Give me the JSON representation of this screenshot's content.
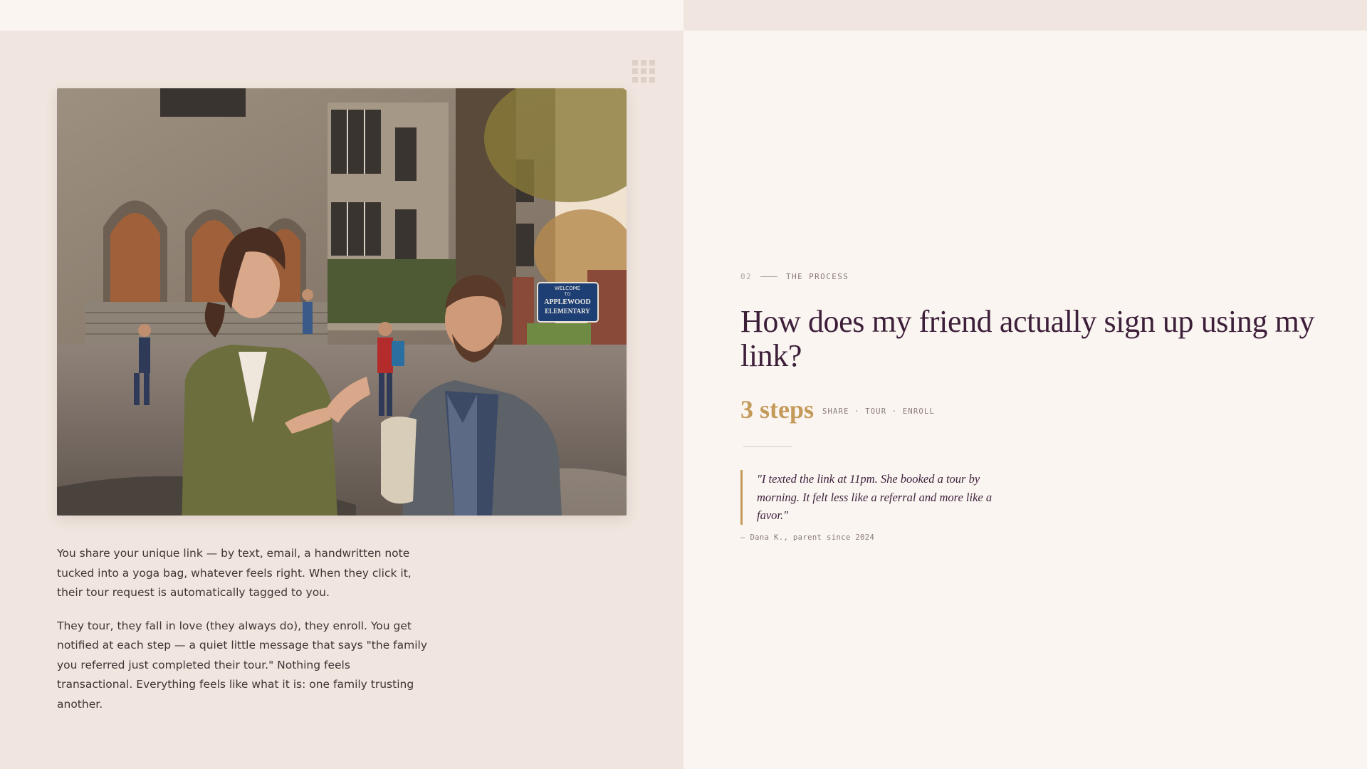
{
  "section": {
    "number": "02",
    "label": "THE PROCESS"
  },
  "headline": "How does my friend actually sign up using my link?",
  "steps": {
    "count_label": "3 steps",
    "names": "SHARE · TOUR · ENROLL"
  },
  "quote": {
    "text": "\"I texted the link at 11pm. She booked a tour by morning. It felt less like a referral and more like a favor.\"",
    "attribution": "— Dana K., parent since 2024"
  },
  "body": {
    "paragraph_1": "You share your unique link — by text, email, a handwritten note tucked into a yoga bag, whatever feels right. When they click it, their tour request is automatically tagged to you.",
    "paragraph_2": "They tour, they fall in love (they always do), they enroll. You get notified at each step — a quiet little message that says \"the family you referred just completed their tour.\" Nothing feels transactional. Everything feels like what it is: one family trusting another."
  },
  "photo": {
    "sign_line_1": "WELCOME",
    "sign_line_2": "TO",
    "sign_line_3": "APPLEWOOD",
    "sign_line_4": "ELEMENTARY"
  },
  "icons": {
    "grid": "grid-icon"
  },
  "colors": {
    "accent_gold": "#c49a5a",
    "headline_plum": "#3d1f3a",
    "left_bg": "#f0e6df",
    "right_bg": "#faf5f1"
  }
}
